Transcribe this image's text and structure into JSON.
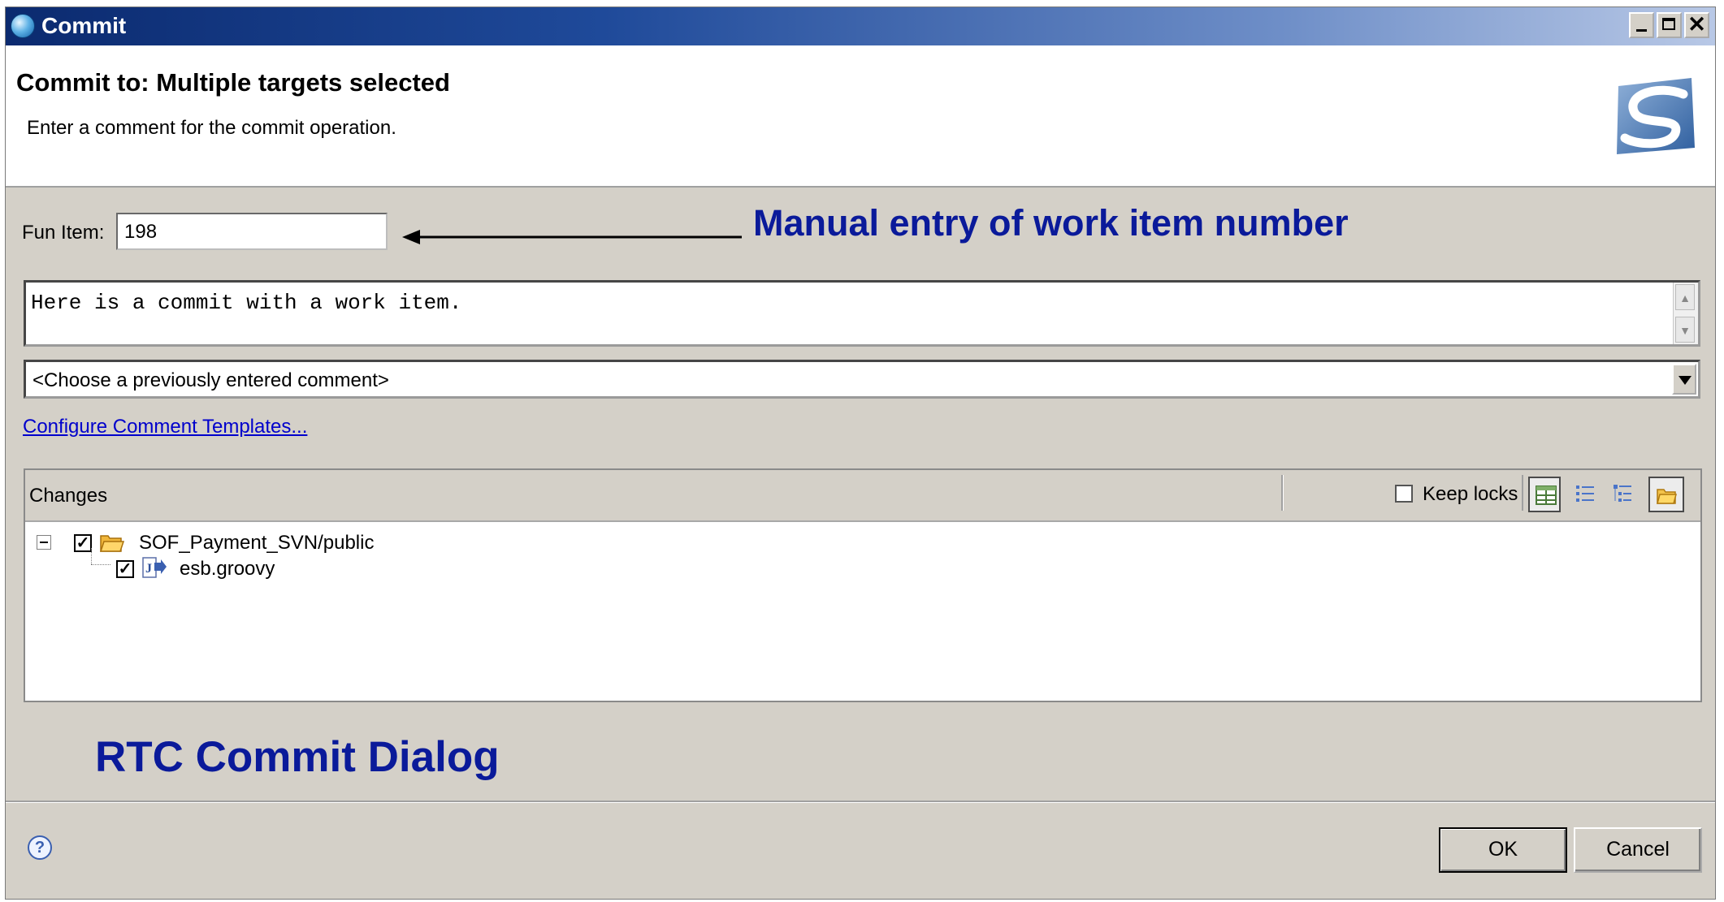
{
  "window": {
    "title": "Commit"
  },
  "header": {
    "title": "Commit to: Multiple targets selected",
    "description": "Enter a comment for the commit operation."
  },
  "fun_item": {
    "label": "Fun Item:",
    "value": "198"
  },
  "annotations": {
    "arrow_note": "Manual entry of work item number",
    "dialog_note": "RTC Commit Dialog"
  },
  "comment": {
    "text": "Here is a commit with a work item."
  },
  "previous_comments": {
    "selected": "<Choose a previously entered comment>"
  },
  "templates_link": "Configure Comment Templates...",
  "changes": {
    "label": "Changes",
    "keep_locks_label": "Keep locks",
    "keep_locks_checked": false,
    "tree": [
      {
        "label": "SOF_Payment_SVN/public",
        "checked": true,
        "icon": "folder-icon",
        "expanded": true
      },
      {
        "label": "esb.groovy",
        "checked": true,
        "icon": "java-file-icon"
      }
    ]
  },
  "buttons": {
    "ok": "OK",
    "cancel": "Cancel"
  },
  "colors": {
    "annotation": "#0a1a9a",
    "dialog_bg": "#d4d0c8",
    "link": "#0000cc"
  }
}
